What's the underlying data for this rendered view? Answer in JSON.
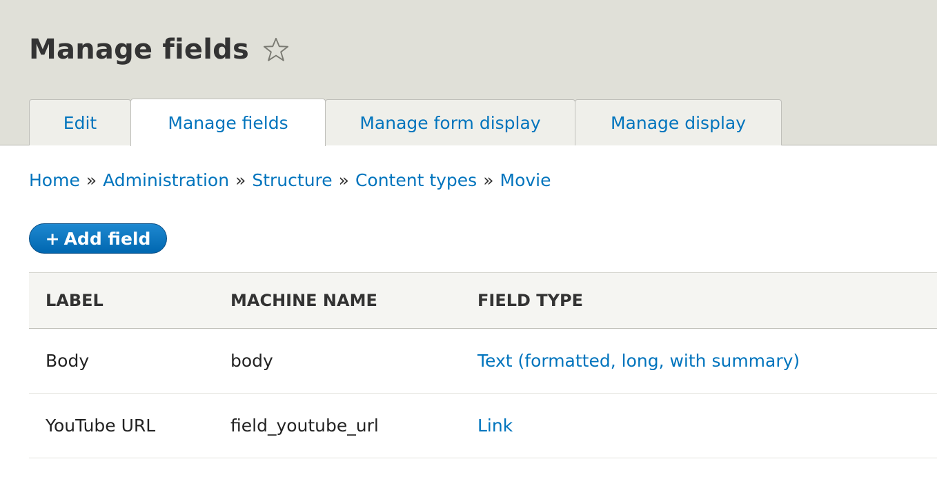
{
  "page": {
    "title": "Manage fields"
  },
  "tabs": [
    {
      "label": "Edit"
    },
    {
      "label": "Manage fields"
    },
    {
      "label": "Manage form display"
    },
    {
      "label": "Manage display"
    }
  ],
  "breadcrumb": [
    {
      "label": "Home"
    },
    {
      "label": "Administration"
    },
    {
      "label": "Structure"
    },
    {
      "label": "Content types"
    },
    {
      "label": "Movie"
    }
  ],
  "breadcrumb_separator": "»",
  "add_field": {
    "label": "Add field",
    "icon": "+"
  },
  "table": {
    "headers": [
      "LABEL",
      "MACHINE NAME",
      "FIELD TYPE"
    ],
    "rows": [
      {
        "label": "Body",
        "machine_name": "body",
        "field_type": "Text (formatted, long, with summary)"
      },
      {
        "label": "YouTube URL",
        "machine_name": "field_youtube_url",
        "field_type": "Link"
      }
    ]
  },
  "icons": {
    "favorite": "star-outline-icon"
  },
  "colors": {
    "link": "#0074bd",
    "header_bg": "#e0e0d8",
    "button": "#0074bd"
  }
}
